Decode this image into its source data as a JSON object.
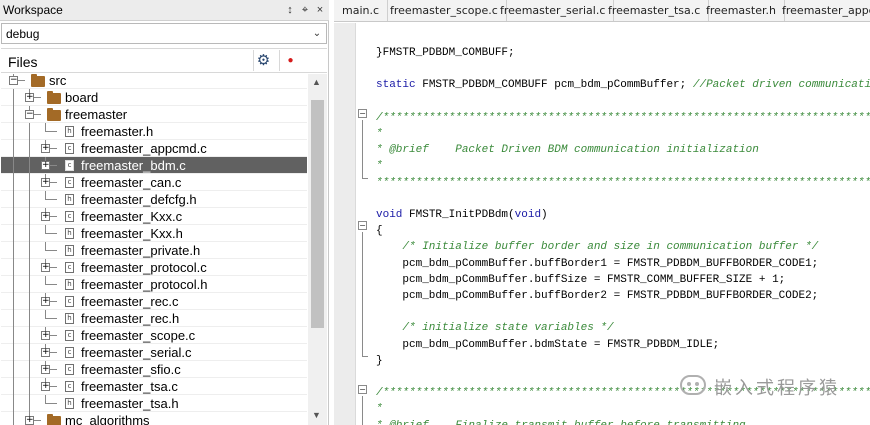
{
  "workspace": {
    "title": "Workspace",
    "pin_glyph": "↕",
    "pin2_glyph": "⌖",
    "close_glyph": "×",
    "config": "debug",
    "dropdown_glyph": "⌄",
    "files_label": "Files",
    "gear_glyph": "⚙",
    "dot_glyph": "●",
    "tree": [
      {
        "label": "src",
        "level": 0,
        "kind": "folder",
        "expander": "minus"
      },
      {
        "label": "board",
        "level": 1,
        "kind": "folder",
        "expander": "plus"
      },
      {
        "label": "freemaster",
        "level": 1,
        "kind": "folder",
        "expander": "minus"
      },
      {
        "label": "freemaster.h",
        "level": 2,
        "kind": "header",
        "expander": "none"
      },
      {
        "label": "freemaster_appcmd.c",
        "level": 2,
        "kind": "source",
        "expander": "plus"
      },
      {
        "label": "freemaster_bdm.c",
        "level": 2,
        "kind": "source",
        "expander": "plus",
        "selected": true
      },
      {
        "label": "freemaster_can.c",
        "level": 2,
        "kind": "source",
        "expander": "plus"
      },
      {
        "label": "freemaster_defcfg.h",
        "level": 2,
        "kind": "header",
        "expander": "none"
      },
      {
        "label": "freemaster_Kxx.c",
        "level": 2,
        "kind": "source",
        "expander": "plus"
      },
      {
        "label": "freemaster_Kxx.h",
        "level": 2,
        "kind": "header",
        "expander": "none"
      },
      {
        "label": "freemaster_private.h",
        "level": 2,
        "kind": "header",
        "expander": "none"
      },
      {
        "label": "freemaster_protocol.c",
        "level": 2,
        "kind": "source",
        "expander": "plus"
      },
      {
        "label": "freemaster_protocol.h",
        "level": 2,
        "kind": "header",
        "expander": "none"
      },
      {
        "label": "freemaster_rec.c",
        "level": 2,
        "kind": "source",
        "expander": "plus"
      },
      {
        "label": "freemaster_rec.h",
        "level": 2,
        "kind": "header",
        "expander": "none"
      },
      {
        "label": "freemaster_scope.c",
        "level": 2,
        "kind": "source",
        "expander": "plus"
      },
      {
        "label": "freemaster_serial.c",
        "level": 2,
        "kind": "source",
        "expander": "plus"
      },
      {
        "label": "freemaster_sfio.c",
        "level": 2,
        "kind": "source",
        "expander": "plus"
      },
      {
        "label": "freemaster_tsa.c",
        "level": 2,
        "kind": "source",
        "expander": "plus"
      },
      {
        "label": "freemaster_tsa.h",
        "level": 2,
        "kind": "header",
        "expander": "none"
      },
      {
        "label": "mc_algorithms",
        "level": 1,
        "kind": "folder",
        "expander": "plus"
      }
    ],
    "file_glyph_c": "c",
    "file_glyph_h": "h",
    "plus_glyph": "+",
    "minus_glyph": "−",
    "scroll_up": "▲",
    "scroll_down": "▼"
  },
  "editor": {
    "tabs": [
      "main.c",
      "freemaster_scope.c",
      "freemaster_serial.c",
      "freemaster_tsa.c",
      "freemaster.h",
      "freemaster_appcmd.c"
    ],
    "fold_minus": "−",
    "lines": [
      {
        "row": 0,
        "parts": [
          {
            "t": "}FMSTR_PDBDM_COMBUFF;",
            "c": "tx"
          }
        ]
      },
      {
        "row": 2,
        "parts": [
          {
            "t": "static ",
            "c": "kw"
          },
          {
            "t": "FMSTR_PDBDM_COMBUFF pcm_bdm_pCommBuffer; ",
            "c": "tx"
          },
          {
            "t": "//Packet driven communication buffer",
            "c": "cm"
          }
        ]
      },
      {
        "row": 4,
        "parts": [
          {
            "t": "/*************************************************************************************",
            "c": "cm"
          }
        ]
      },
      {
        "row": 5,
        "parts": [
          {
            "t": "*",
            "c": "cm"
          }
        ]
      },
      {
        "row": 6,
        "parts": [
          {
            "t": "* @brief    Packet Driven BDM communication initialization",
            "c": "cm"
          }
        ]
      },
      {
        "row": 7,
        "parts": [
          {
            "t": "*",
            "c": "cm"
          }
        ]
      },
      {
        "row": 8,
        "parts": [
          {
            "t": "**************************************************************************************",
            "c": "cm"
          }
        ]
      },
      {
        "row": 10,
        "parts": [
          {
            "t": "void ",
            "c": "kw"
          },
          {
            "t": "FMSTR_InitPDBdm(",
            "c": "tx"
          },
          {
            "t": "void",
            "c": "kw"
          },
          {
            "t": ")",
            "c": "tx"
          }
        ]
      },
      {
        "row": 11,
        "parts": [
          {
            "t": "{",
            "c": "tx"
          }
        ]
      },
      {
        "row": 12,
        "parts": [
          {
            "t": "    /* Initialize buffer border and size in communication buffer */",
            "c": "cm"
          }
        ]
      },
      {
        "row": 13,
        "parts": [
          {
            "t": "    pcm_bdm_pCommBuffer.buffBorder1 = FMSTR_PDBDM_BUFFBORDER_CODE1;",
            "c": "tx"
          }
        ]
      },
      {
        "row": 14,
        "parts": [
          {
            "t": "    pcm_bdm_pCommBuffer.buffSize = FMSTR_COMM_BUFFER_SIZE + 1;",
            "c": "tx"
          }
        ]
      },
      {
        "row": 15,
        "parts": [
          {
            "t": "    pcm_bdm_pCommBuffer.buffBorder2 = FMSTR_PDBDM_BUFFBORDER_CODE2;",
            "c": "tx"
          }
        ]
      },
      {
        "row": 17,
        "parts": [
          {
            "t": "    /* initialize state variables */",
            "c": "cm"
          }
        ]
      },
      {
        "row": 18,
        "parts": [
          {
            "t": "    pcm_bdm_pCommBuffer.bdmState = FMSTR_PDBDM_IDLE;",
            "c": "tx"
          }
        ]
      },
      {
        "row": 19,
        "parts": [
          {
            "t": "}",
            "c": "tx"
          }
        ]
      },
      {
        "row": 21,
        "parts": [
          {
            "t": "/*************************************************************************************",
            "c": "cm"
          }
        ]
      },
      {
        "row": 22,
        "parts": [
          {
            "t": "*",
            "c": "cm"
          }
        ]
      },
      {
        "row": 23,
        "parts": [
          {
            "t": "* @brief    Finalize transmit buffer before transmitting",
            "c": "cm"
          }
        ]
      }
    ]
  },
  "watermark": "嵌入式程序猿"
}
